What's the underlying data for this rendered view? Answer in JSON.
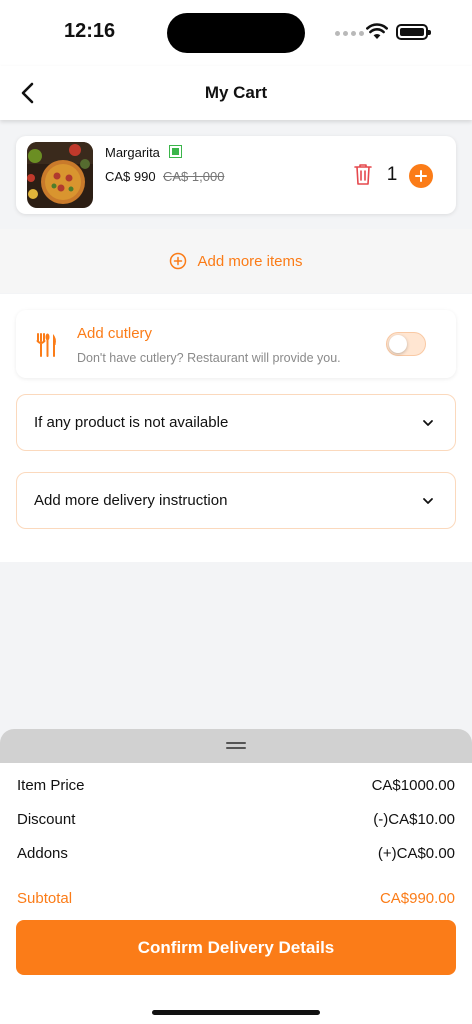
{
  "status_bar": {
    "time": "12:16"
  },
  "header": {
    "title": "My Cart"
  },
  "cart": {
    "items": [
      {
        "name": "Margarita",
        "price": "CA$ 990",
        "old_price": "CA$ 1,000",
        "quantity": "1"
      }
    ],
    "add_more_label": "Add more items"
  },
  "cutlery": {
    "title": "Add cutlery",
    "subtitle": "Don't have cutlery? Restaurant will provide you.",
    "enabled": false
  },
  "accordions": [
    {
      "label": "If any product is not available"
    },
    {
      "label": "Add more delivery instruction"
    }
  ],
  "summary": {
    "rows": [
      {
        "label": "Item Price",
        "value": "CA$1000.00"
      },
      {
        "label": "Discount",
        "value": "(-)CA$10.00"
      },
      {
        "label": "Addons",
        "value": "(+)CA$0.00"
      }
    ],
    "subtotal": {
      "label": "Subtotal",
      "value": "CA$990.00"
    }
  },
  "confirm_button": "Confirm Delivery Details",
  "colors": {
    "accent": "#fb7c18",
    "veg": "#3bb54a",
    "delete": "#e5484d"
  }
}
